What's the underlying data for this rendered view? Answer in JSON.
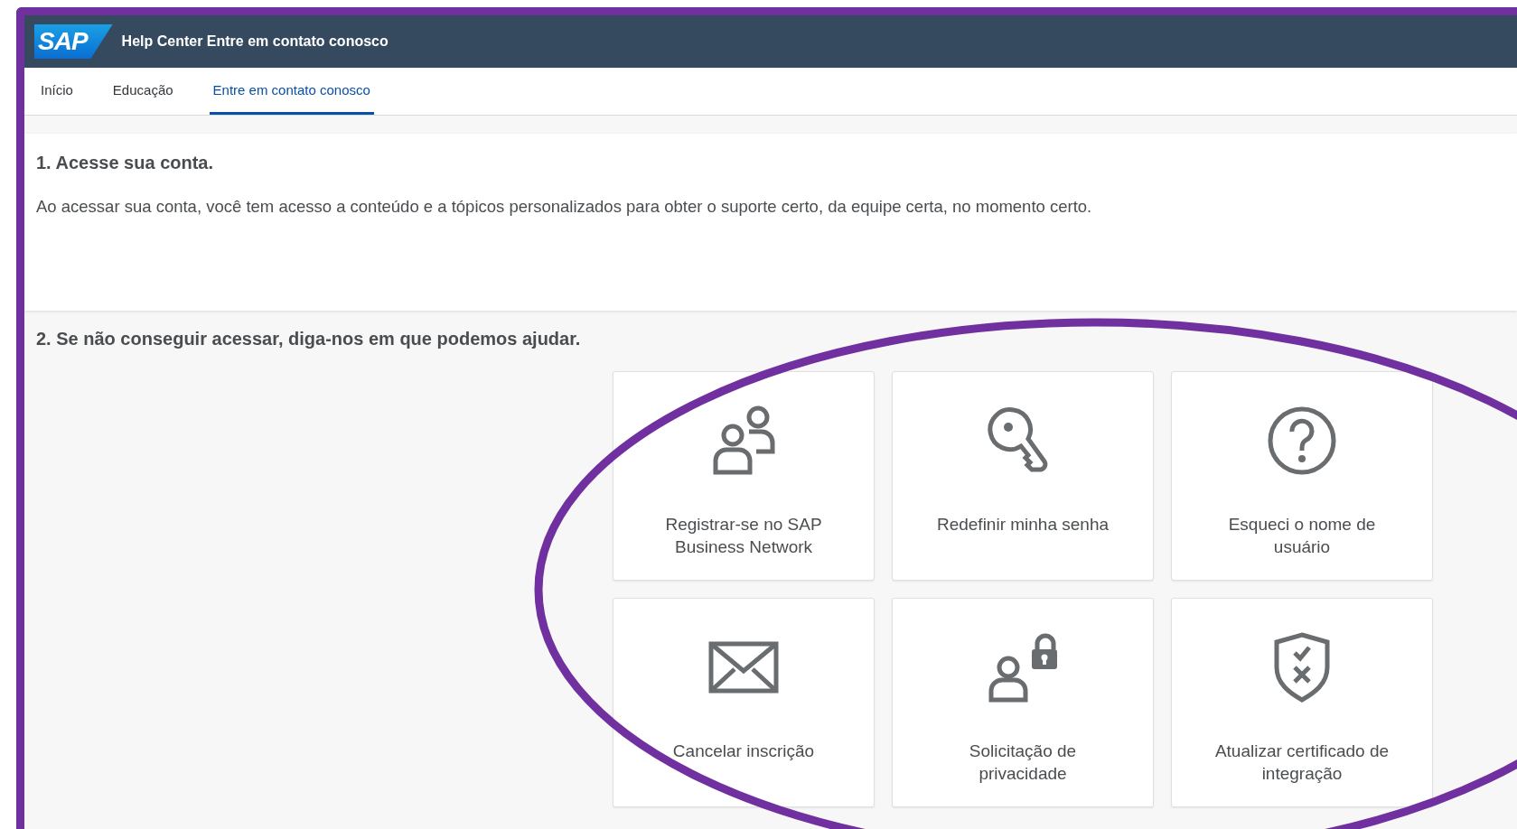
{
  "header": {
    "logo": "SAP",
    "title": "Help Center Entre em contato conosco"
  },
  "tabs": [
    {
      "label": "Início",
      "selected": false
    },
    {
      "label": "Educação",
      "selected": false
    },
    {
      "label": "Entre em contato conosco",
      "selected": true
    }
  ],
  "section_1": {
    "heading": "1. Acesse sua conta.",
    "text": "Ao acessar sua conta, você tem acesso a conteúdo e a tópicos personalizados para obter o suporte certo, da equipe certa, no momento certo."
  },
  "section_2": {
    "heading": "2. Se não conseguir acessar, diga-nos em que podemos ajudar.",
    "cards": [
      {
        "kind": "users",
        "label": "Registrar-se no SAP Business Network"
      },
      {
        "kind": "key",
        "label": "Redefinir minha senha"
      },
      {
        "kind": "question",
        "label": "Esqueci o nome de usuário"
      },
      {
        "kind": "mail",
        "label": "Cancelar inscrição"
      },
      {
        "kind": "privacy",
        "label": "Solicitação de privacidade"
      },
      {
        "kind": "shield",
        "label": "Atualizar certificado de integração"
      }
    ]
  }
}
